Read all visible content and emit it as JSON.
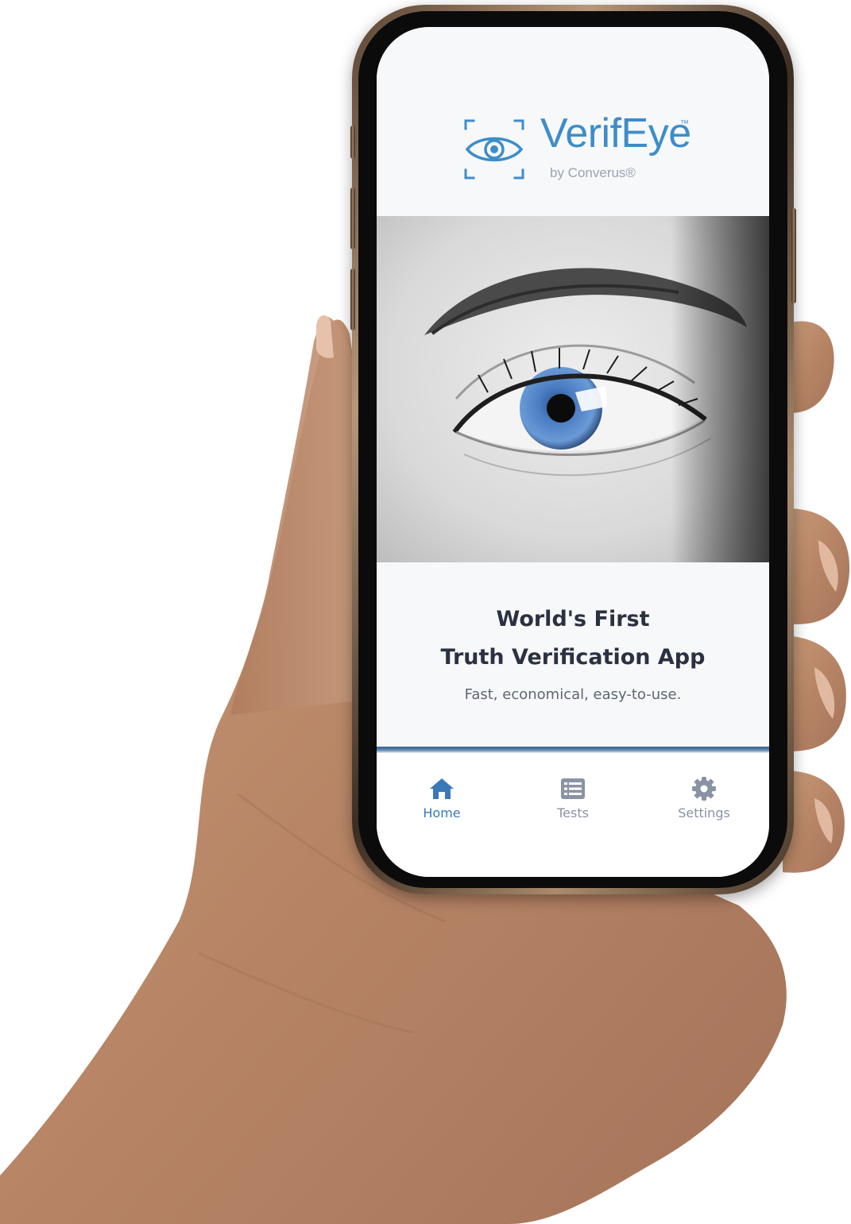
{
  "app": {
    "name": "VerifEye",
    "trademark": "™",
    "byline": "by Converus®"
  },
  "hero": {
    "image": "close-up of a human eye with blue iris"
  },
  "content": {
    "headline_line1": "World's First",
    "headline_line2": "Truth Verification App",
    "tagline": "Fast, economical, easy-to-use."
  },
  "tabbar": {
    "tabs": [
      {
        "label": "Home",
        "icon": "home-icon",
        "active": true
      },
      {
        "label": "Tests",
        "icon": "list-icon",
        "active": false
      },
      {
        "label": "Settings",
        "icon": "gear-icon",
        "active": false
      }
    ]
  },
  "colors": {
    "brand": "#3d8dc9",
    "active_tab": "#3a78b8",
    "inactive_tab": "#8a93a3",
    "headline": "#2b3140",
    "divider": "#2f5f93"
  }
}
